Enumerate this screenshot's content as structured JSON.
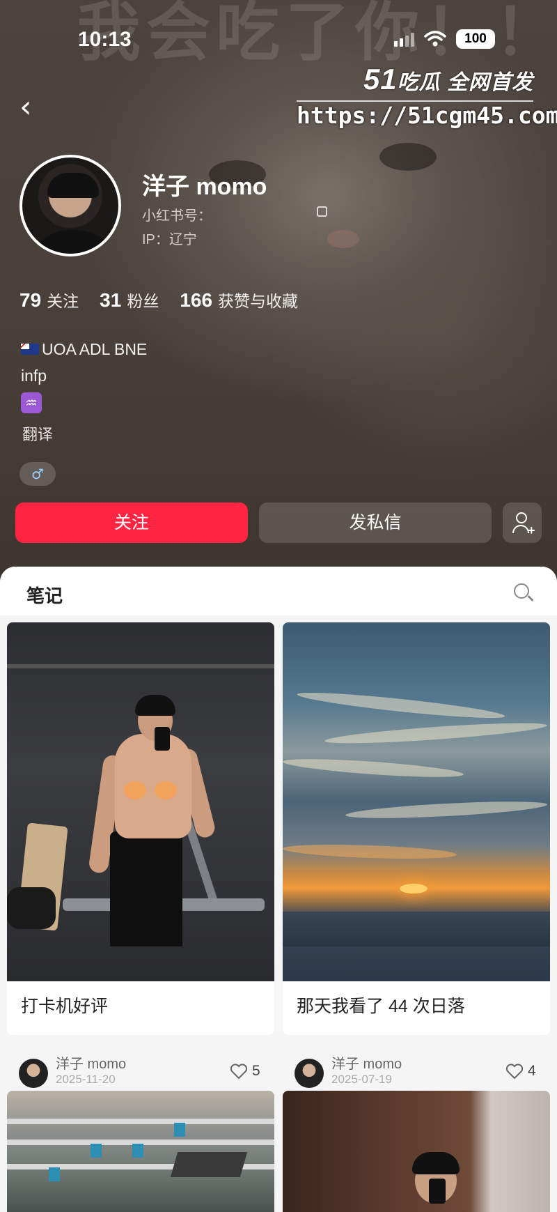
{
  "status_bar": {
    "time": "10:13",
    "battery": "100"
  },
  "background_text": "我会吃了你！！",
  "watermark": {
    "logo_num": "51",
    "logo_text": "吃瓜 全网首发",
    "url": "https://51cgm45.com"
  },
  "profile": {
    "nickname": "洋子 momo",
    "red_id_label": "小红书号：",
    "ip": "IP：辽宁",
    "stats": [
      {
        "num": "79",
        "label": "关注"
      },
      {
        "num": "31",
        "label": "粉丝"
      },
      {
        "num": "166",
        "label": "获赞与收藏"
      }
    ],
    "bio": {
      "line1": "UOA ADL BNE",
      "line2": "infp",
      "zodiac": "♒"
    },
    "translate": "翻译",
    "gender": "♂"
  },
  "actions": {
    "follow": "关注",
    "message": "发私信"
  },
  "notes": {
    "tab_label": "笔记",
    "cards": [
      {
        "title": "打卡机好评",
        "author": "洋子 momo",
        "date": "2025-11-20",
        "likes": "5"
      },
      {
        "title": "那天我看了 44 次日落",
        "author": "洋子 momo",
        "date": "2025-07-19",
        "likes": "4"
      }
    ]
  }
}
